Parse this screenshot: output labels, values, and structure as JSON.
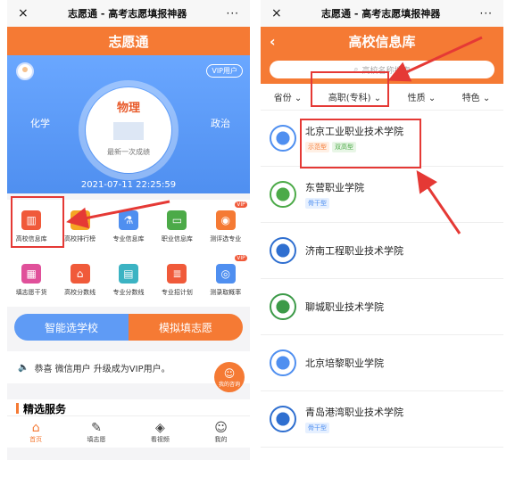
{
  "left": {
    "wechat_bar": {
      "close": "×",
      "title": "志愿通 - 高考志愿填报神器",
      "more": "···"
    },
    "app_title": "志愿通",
    "vip_badge": "VIP用户",
    "score_card": {
      "subject_main": "物理",
      "subject_left": "化学",
      "subject_right": "政治",
      "score_label": "最新一次成绩",
      "datetime": "2021-07-11 22:25:59"
    },
    "grid": [
      {
        "label": "高校信息库",
        "icon": "building-icon",
        "color": "#f05a3a"
      },
      {
        "label": "高校排行榜",
        "icon": "ranking-icon",
        "color": "#f5a623"
      },
      {
        "label": "专业信息库",
        "icon": "microscope-icon",
        "color": "#4f8ff0"
      },
      {
        "label": "职业信息库",
        "icon": "briefcase-icon",
        "color": "#4caa48"
      },
      {
        "label": "测评选专业",
        "icon": "assessment-icon",
        "color": "#f57a34",
        "badge": "VIP"
      },
      {
        "label": "填志愿干货",
        "icon": "grid-icon",
        "color": "#e0509a"
      },
      {
        "label": "高校分数线",
        "icon": "bank-icon",
        "color": "#f05a3a"
      },
      {
        "label": "专业分数线",
        "icon": "chart-icon",
        "color": "#3bb3c3"
      },
      {
        "label": "专业招计划",
        "icon": "list-icon",
        "color": "#f05a3a"
      },
      {
        "label": "测录取概率",
        "icon": "probability-icon",
        "color": "#4f8ff0",
        "badge": "VIP"
      }
    ],
    "buttons": {
      "smart": "智能选学校",
      "simulate": "模拟填志愿"
    },
    "notice": "恭喜 微信用户 升级成为VIP用户。",
    "fab_label": "我的咨询",
    "section_title": "精选服务",
    "tabs": [
      {
        "label": "首页",
        "icon": "home-icon"
      },
      {
        "label": "填志愿",
        "icon": "edit-icon"
      },
      {
        "label": "看视频",
        "icon": "video-icon"
      },
      {
        "label": "我的",
        "icon": "user-icon"
      }
    ]
  },
  "right": {
    "wechat_bar": {
      "close": "×",
      "title": "志愿通 - 高考志愿填报神器",
      "more": "···"
    },
    "page_title": "高校信息库",
    "back": "‹",
    "search_placeholder": "高校名称搜索",
    "filters": [
      "省份",
      "高职(专科)",
      "性质",
      "特色"
    ],
    "schools": [
      {
        "name": "北京工业职业技术学院",
        "tags": [
          "示范型",
          "双高型"
        ],
        "color": "#4f8ff0"
      },
      {
        "name": "东营职业学院",
        "tags": [
          "骨干型"
        ],
        "color": "#4caa48"
      },
      {
        "name": "济南工程职业技术学院",
        "tags": [],
        "color": "#2f6fd0"
      },
      {
        "name": "聊城职业技术学院",
        "tags": [],
        "color": "#3c9a48"
      },
      {
        "name": "北京培黎职业学院",
        "tags": [],
        "color": "#4f8ff0"
      },
      {
        "name": "青岛港湾职业技术学院",
        "tags": [
          "骨干型"
        ],
        "color": "#2f6fd0"
      }
    ]
  }
}
